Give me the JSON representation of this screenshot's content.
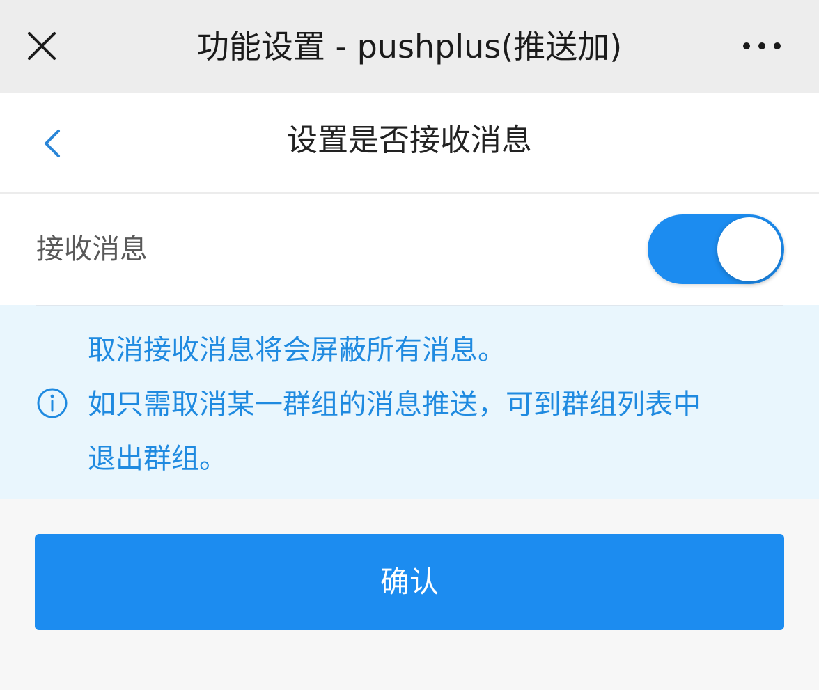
{
  "window": {
    "title": "功能设置 - pushplus(推送加)",
    "close_icon": "close-icon",
    "more_icon": "more-horizontal-icon"
  },
  "page": {
    "title": "设置是否接收消息",
    "back_icon": "chevron-left-icon"
  },
  "setting": {
    "label": "接收消息",
    "toggle_on": true
  },
  "notice": {
    "icon": "info-icon",
    "lines": [
      "取消接收消息将会屏蔽所有消息。",
      "如只需取消某一群组的消息推送，可到群组列表中",
      "退出群组。"
    ]
  },
  "confirm_label": "确认",
  "colors": {
    "accent": "#1c8cf0",
    "notice_bg": "#e9f6fd",
    "notice_text": "#1f8ae0",
    "topbar_bg": "#ededed"
  }
}
